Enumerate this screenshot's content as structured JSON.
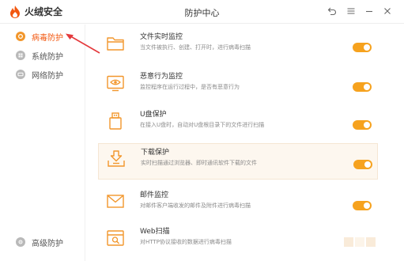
{
  "app": {
    "name": "火绒安全",
    "window_title": "防护中心"
  },
  "colors": {
    "accent": "#f2570f",
    "toggle_on": "#f6a21e",
    "icon_orange": "#f2962b",
    "arrow": "#e4393c"
  },
  "sidebar": {
    "items": [
      {
        "label": "病毒防护",
        "icon": "virus-shield-icon",
        "active": true
      },
      {
        "label": "系统防护",
        "icon": "system-shield-icon",
        "active": false
      },
      {
        "label": "网络防护",
        "icon": "network-shield-icon",
        "active": false
      },
      {
        "label": "高级防护",
        "icon": "advanced-shield-icon",
        "active": false
      }
    ]
  },
  "features": [
    {
      "title": "文件实时监控",
      "desc": "当文件被执行、创建、打开时，进行病毒扫描",
      "icon": "folder-icon",
      "enabled": true
    },
    {
      "title": "恶意行为监控",
      "desc": "监控程序在运行过程中，是否有恶意行为",
      "icon": "eye-monitor-icon",
      "enabled": true
    },
    {
      "title": "U盘保护",
      "desc": "在接入U盘时，自动对U盘根目录下的文件进行扫描",
      "icon": "usb-drive-icon",
      "enabled": true
    },
    {
      "title": "下载保护",
      "desc": "实时扫描通过浏览器、即时通讯软件下载的文件",
      "icon": "download-tray-icon",
      "enabled": true
    },
    {
      "title": "邮件监控",
      "desc": "对邮件客户端收发的邮件及附件进行病毒扫描",
      "icon": "mail-icon",
      "enabled": true
    },
    {
      "title": "Web扫描",
      "desc": "对HTTP协议接收的数据进行病毒扫描",
      "icon": "web-scan-icon",
      "enabled": true
    }
  ]
}
